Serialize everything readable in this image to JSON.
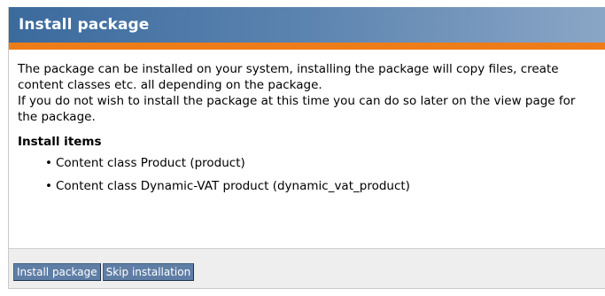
{
  "window": {
    "title": "Install package"
  },
  "content": {
    "paragraph_1": "The package can be installed on your system, installing the package will copy files, create content classes etc. all depending on the package.",
    "paragraph_2": "If you do not wish to install the package at this time you can do so later on the view page for the package.",
    "install_items_heading": "Install items",
    "install_items": [
      {
        "label": "Content class Product (product)"
      },
      {
        "label": "Content class Dynamic-VAT product (dynamic_vat_product)"
      }
    ]
  },
  "footer": {
    "install_button_label": "Install package",
    "skip_button_label": "Skip installation"
  },
  "colors": {
    "header_blue": "#3b6a9d",
    "accent_orange": "#ee7d19",
    "button_blue": "#5f7ea5",
    "footer_gray": "#eeeeee"
  }
}
